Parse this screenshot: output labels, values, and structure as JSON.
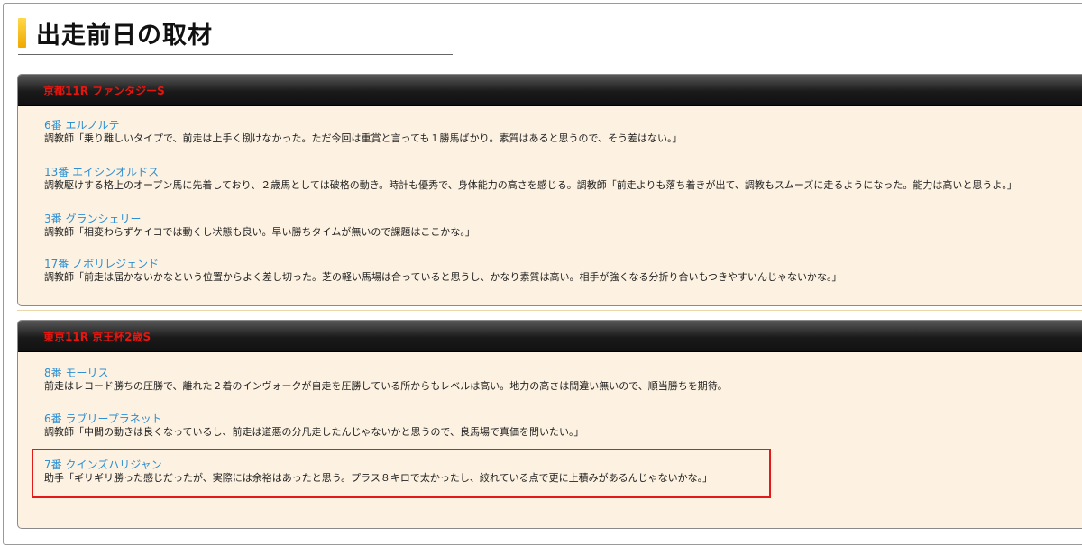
{
  "page": {
    "heading": "出走前日の取材"
  },
  "races": [
    {
      "title": "京都11R ファンタジーS",
      "horses": [
        {
          "name": "6番 エルノルテ",
          "comment": "調教師「乗り難しいタイプで、前走は上手く捌けなかった。ただ今回は重賞と言っても１勝馬ばかり。素質はあると思うので、そう差はない。」"
        },
        {
          "name": "13番 エイシンオルドス",
          "comment": "調教駆けする格上のオープン馬に先着しており、２歳馬としては破格の動き。時計も優秀で、身体能力の高さを感じる。調教師「前走よりも落ち着きが出て、調教もスムーズに走るようになった。能力は高いと思うよ。」"
        },
        {
          "name": "3番 グランシェリー",
          "comment": "調教師「相変わらずケイコでは動くし状態も良い。早い勝ちタイムが無いので課題はここかな。」"
        },
        {
          "name": "17番 ノボリレジェンド",
          "comment": "調教師「前走は届かないかなという位置からよく差し切った。芝の軽い馬場は合っていると思うし、かなり素質は高い。相手が強くなる分折り合いもつきやすいんじゃないかな。」"
        }
      ]
    },
    {
      "title": "東京11R 京王杯2歳S",
      "horses": [
        {
          "name": "8番 モーリス",
          "comment": "前走はレコード勝ちの圧勝で、離れた２着のインヴォークが自走を圧勝している所からもレベルは高い。地力の高さは間違い無いので、順当勝ちを期待。"
        },
        {
          "name": "6番 ラブリープラネット",
          "comment": "調教師「中間の動きは良くなっているし、前走は道悪の分凡走したんじゃないかと思うので、良馬場で真価を問いたい。」"
        },
        {
          "name": "7番 クインズハリジャン",
          "comment": "助手「ギリギリ勝った感じだったが、実際には余裕はあったと思う。プラス８キロで太かったし、絞れている点で更に上積みがあるんじゃないかな。」"
        }
      ]
    }
  ],
  "colors": {
    "race_title": "#e8150f",
    "horse_link": "#2d8fd2",
    "panel_bg": "#fdf2e1",
    "highlight": "#e21a1a"
  }
}
